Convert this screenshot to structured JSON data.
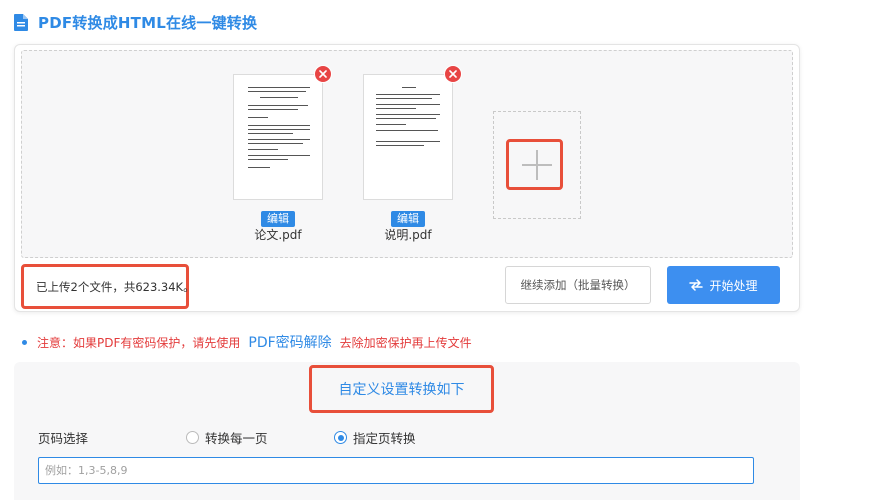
{
  "header": {
    "title": "PDF转换成HTML在线一键转换"
  },
  "files": [
    {
      "name": "论文.pdf",
      "edit_label": "编辑"
    },
    {
      "name": "说明.pdf",
      "edit_label": "编辑"
    }
  ],
  "upload_panel": {
    "status": "已上传2个文件，共623.34K。",
    "continue_label": "继续添加（批量转换）",
    "start_label": "开始处理"
  },
  "notice": {
    "prefix": "注意：如果PDF有密码保护，请先使用",
    "link": "PDF密码解除",
    "suffix": "去除加密保护再上传文件"
  },
  "settings": {
    "title": "自定义设置转换如下",
    "page_label": "页码选择",
    "option_each_page": "转换每一页",
    "option_specific": "指定页转换",
    "selected_option": "指定页转换",
    "input_value": "",
    "input_placeholder": "例如：1,3-5,8,9"
  },
  "colors": {
    "accent": "#2f8ae5",
    "highlight": "#e84f3a",
    "danger": "#e84545"
  }
}
